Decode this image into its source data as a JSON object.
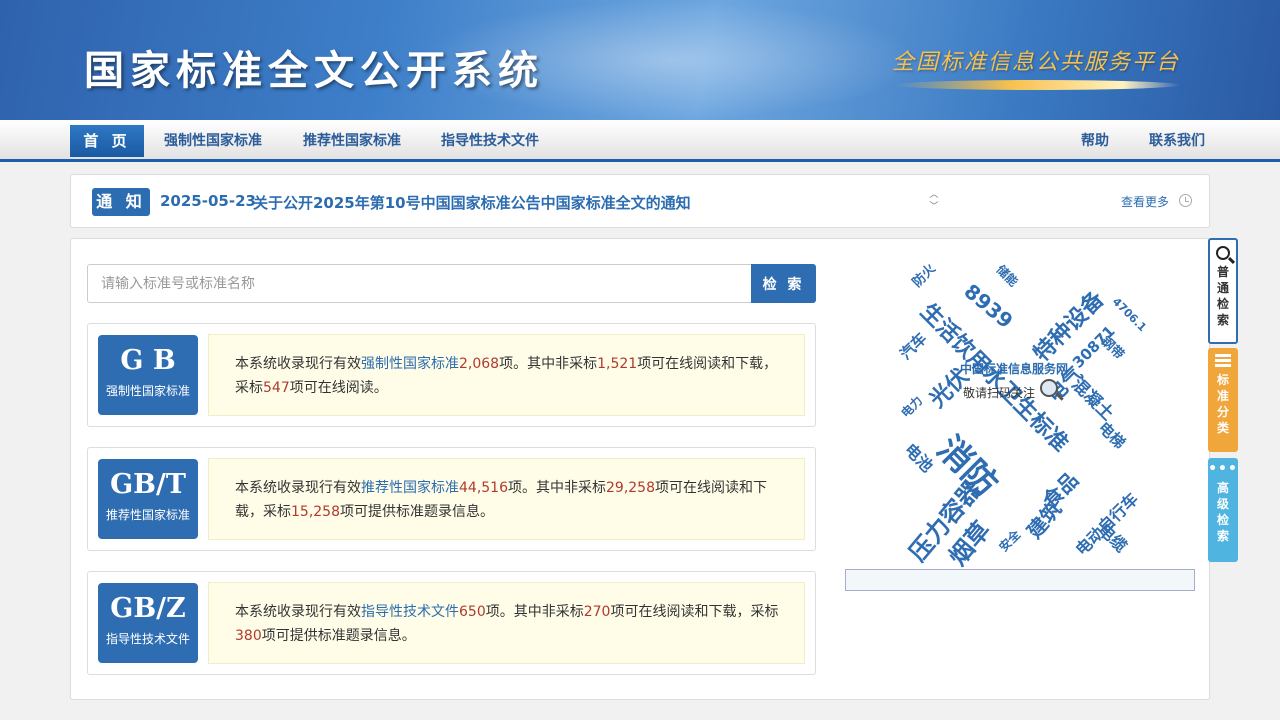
{
  "header": {
    "title": "国家标准全文公开系统",
    "slogan": "全国标准信息公共服务平台"
  },
  "nav": {
    "items": [
      "首 页",
      "强制性国家标准",
      "推荐性国家标准",
      "指导性技术文件"
    ],
    "right": [
      "帮助",
      "联系我们"
    ]
  },
  "notice": {
    "tag": "通 知",
    "date": "2025-05-23",
    "text": "关于公开2025年第10号中国国家标准公告中国家标准全文的通知",
    "more": "查看更多"
  },
  "search": {
    "placeholder": "请输入标准号或标准名称",
    "button": "检 索"
  },
  "cards": [
    {
      "code": "G B",
      "sub": "强制性国家标准",
      "p1": "本系统收录现行有效",
      "link": "强制性国家标准",
      "n1": "2,068",
      "p2": "项。其中非采标",
      "n2": "1,521",
      "p3": "项可在线阅读和下载，采标",
      "n3": "547",
      "p4": "项可在线阅读。"
    },
    {
      "code": "GB/T",
      "sub": "推荐性国家标准",
      "p1": "本系统收录现行有效",
      "link": "推荐性国家标准",
      "n1": "44,516",
      "p2": "项。其中非采标",
      "n2": "29,258",
      "p3": "项可在线阅读和下载，采标",
      "n3": "15,258",
      "p4": "项可提供标准题录信息。"
    },
    {
      "code": "GB/Z",
      "sub": "指导性技术文件",
      "p1": "本系统收录现行有效",
      "link": "指导性技术文件",
      "n1": "650",
      "p2": "项。其中非采标",
      "n2": "270",
      "p3": "项可在线阅读和下载，采标",
      "n3": "380",
      "p4": "项可提供标准题录信息。"
    }
  ],
  "word_cloud": [
    "防火",
    "储能",
    "8939",
    "特种设备",
    "4706.1",
    "汽车",
    "生活饮用水卫生标准",
    "30871",
    "钢带",
    "电气",
    "光伏",
    "混凝土",
    "电力",
    "消防",
    "电梯",
    "电池",
    "食品",
    "压力容器",
    "烟草",
    "建筑",
    "电动自行车",
    "安全",
    "电缆"
  ],
  "qr": {
    "title": "中国标准信息服务网",
    "caption": "敬请扫码关注"
  },
  "side_tabs": [
    "普通检索",
    "标准分类",
    "高级检索"
  ],
  "colors": {
    "primary": "#2f6db2",
    "number": "#b03a2e",
    "orange_tab": "#f0a63a",
    "cyan_tab": "#4fb4e0"
  }
}
